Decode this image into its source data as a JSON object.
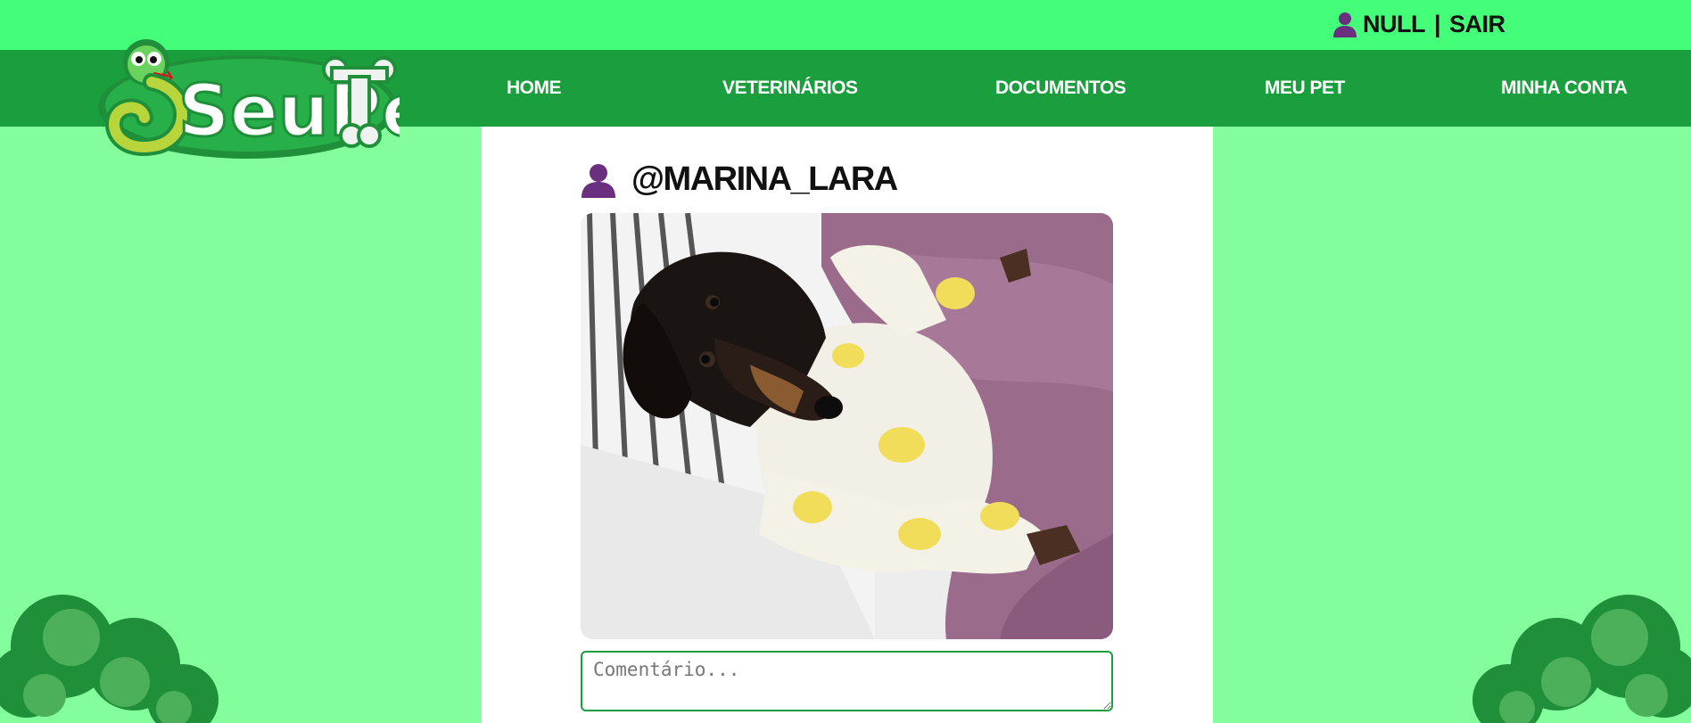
{
  "header": {
    "user_name": "NULL",
    "separator": "|",
    "logout_label": "SAIR"
  },
  "logo": {
    "text": "SeuPet"
  },
  "nav": {
    "items": [
      {
        "label": "HOME"
      },
      {
        "label": "VETERINÁRIOS"
      },
      {
        "label": "DOCUMENTOS"
      },
      {
        "label": "MEU PET"
      },
      {
        "label": "MINHA CONTA"
      }
    ]
  },
  "post": {
    "username": "@MARINA_LARA",
    "photo_icon": "dachshund-photo"
  },
  "comment": {
    "placeholder": "Comentário..."
  },
  "colors": {
    "topbar": "#44fd79",
    "navbar": "#1a9e3e",
    "background": "#84fd9c",
    "user_icon": "#6a2f7e"
  }
}
